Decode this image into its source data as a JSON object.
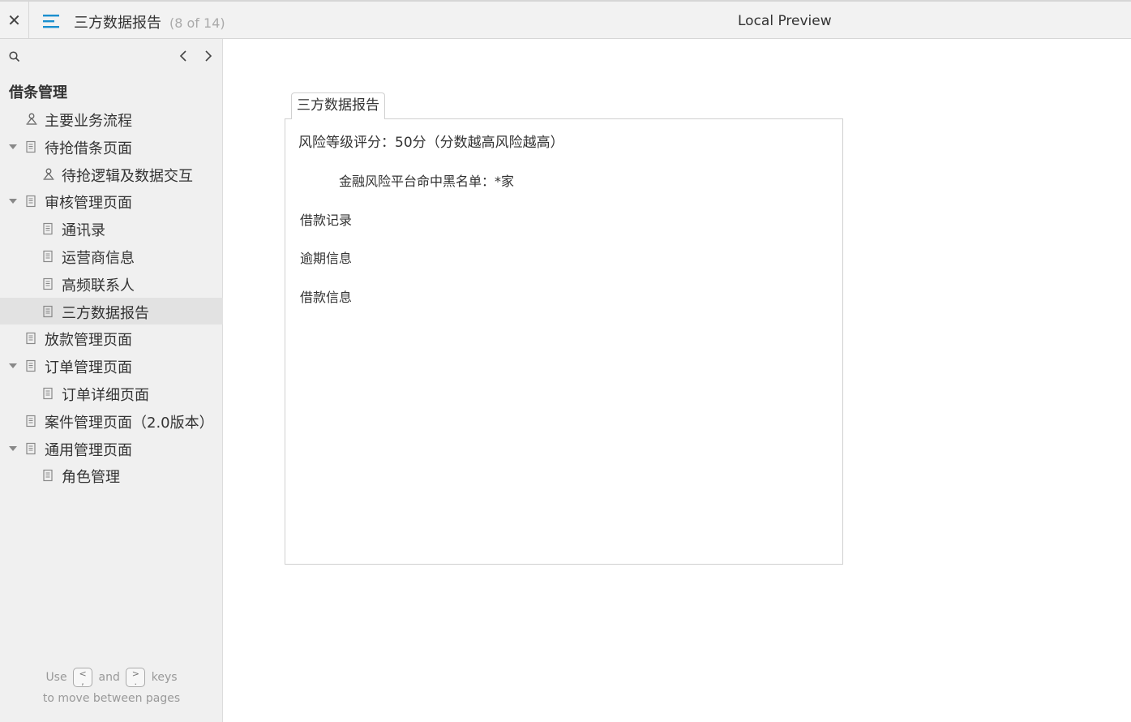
{
  "topbar": {
    "close_glyph": "✕",
    "title": "三方数据报告",
    "page_count": "(8 of 14)",
    "center_title": "Local Preview"
  },
  "sidebar": {
    "project_title": "借条管理",
    "items": [
      {
        "label": "主要业务流程",
        "icon": "flow-icon",
        "level": 1,
        "expandable": false
      },
      {
        "label": "待抢借条页面",
        "icon": "page-icon",
        "level": 1,
        "expandable": true
      },
      {
        "label": "待抢逻辑及数据交互",
        "icon": "flow-icon",
        "level": 2,
        "expandable": false
      },
      {
        "label": "审核管理页面",
        "icon": "page-icon",
        "level": 1,
        "expandable": true
      },
      {
        "label": "通讯录",
        "icon": "page-icon",
        "level": 2,
        "expandable": false
      },
      {
        "label": "运营商信息",
        "icon": "page-icon",
        "level": 2,
        "expandable": false
      },
      {
        "label": "高频联系人",
        "icon": "page-icon",
        "level": 2,
        "expandable": false
      },
      {
        "label": "三方数据报告",
        "icon": "page-icon",
        "level": 2,
        "expandable": false,
        "active": true
      },
      {
        "label": "放款管理页面",
        "icon": "page-icon",
        "level": 1,
        "expandable": false
      },
      {
        "label": "订单管理页面",
        "icon": "page-icon",
        "level": 1,
        "expandable": true
      },
      {
        "label": "订单详细页面",
        "icon": "page-icon",
        "level": 2,
        "expandable": false
      },
      {
        "label": "案件管理页面（2.0版本）",
        "icon": "page-icon",
        "level": 1,
        "expandable": false
      },
      {
        "label": "通用管理页面",
        "icon": "page-icon",
        "level": 1,
        "expandable": true
      },
      {
        "label": "角色管理",
        "icon": "page-icon",
        "level": 2,
        "expandable": false
      }
    ],
    "hint": {
      "use": "Use",
      "prev_key": "<\n,",
      "and": "and",
      "next_key": ">\n.",
      "keys": "keys",
      "line2": "to move between pages"
    }
  },
  "content": {
    "tab_label": "三方数据报告",
    "risk_score": "风险等级评分：50分（分数越高风险越高）",
    "blacklist": "金融风险平台命中黑名单：*家",
    "section1": "借款记录",
    "section2": "逾期信息",
    "section3": "借款信息"
  },
  "colors": {
    "accent": "#1a8fce",
    "sidebar_bg": "#f0f0f0",
    "active_item_bg": "#e2e2e2"
  }
}
